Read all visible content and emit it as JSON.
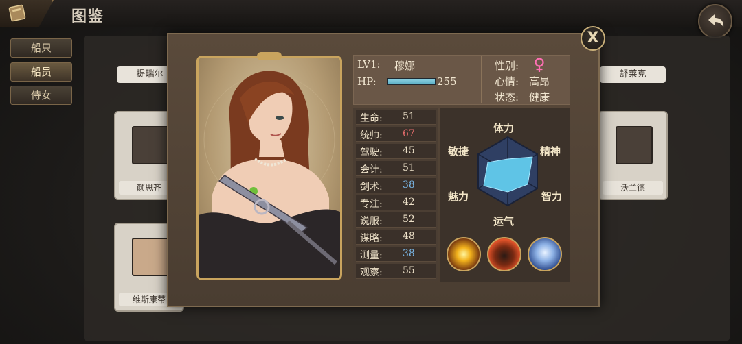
{
  "header": {
    "title": "图鉴",
    "book_icon": "book-icon",
    "back_icon": "back-arrow-icon"
  },
  "sidebar": {
    "tabs": [
      {
        "label": "船只"
      },
      {
        "label": "船员"
      },
      {
        "label": "侍女"
      }
    ],
    "active_index": 1
  },
  "background_list": {
    "left_top_name": "提瑞尔",
    "right_top_name": "舒莱克",
    "cards": [
      {
        "name": "颜思齐"
      },
      {
        "name": "沃兰德"
      },
      {
        "name": "维斯康蒂"
      }
    ]
  },
  "modal": {
    "close_label": "X",
    "character": {
      "level": "LV1:",
      "name": "穆娜",
      "hp_label": "HP:",
      "hp_value": "255",
      "hp_fill_percent": 100,
      "gender_label": "性别:",
      "gender_icon": "female-symbol-icon",
      "mood_label": "心情:",
      "mood_value": "高昂",
      "status_label": "状态:",
      "status_value": "健康"
    },
    "stats": [
      {
        "name": "生命:",
        "value": "51"
      },
      {
        "name": "统帅:",
        "value": "67"
      },
      {
        "name": "驾驶:",
        "value": "45"
      },
      {
        "name": "会计:",
        "value": "51"
      },
      {
        "name": "剑术:",
        "value": "38"
      },
      {
        "name": "专注:",
        "value": "42"
      },
      {
        "name": "说服:",
        "value": "52"
      },
      {
        "name": "谋略:",
        "value": "48"
      },
      {
        "name": "测量:",
        "value": "38"
      },
      {
        "name": "观察:",
        "value": "55"
      }
    ],
    "radar": {
      "labels": {
        "top": "体力",
        "top_right": "精神",
        "bottom_right": "智力",
        "bottom": "运气",
        "bottom_left": "魅力",
        "top_left": "敏捷"
      },
      "fill_color": "#5fc4e6"
    },
    "skills": [
      {
        "icon": "fire-orb-skill-icon"
      },
      {
        "icon": "pirate-hat-skill-icon"
      },
      {
        "icon": "angel-skill-icon"
      }
    ]
  }
}
